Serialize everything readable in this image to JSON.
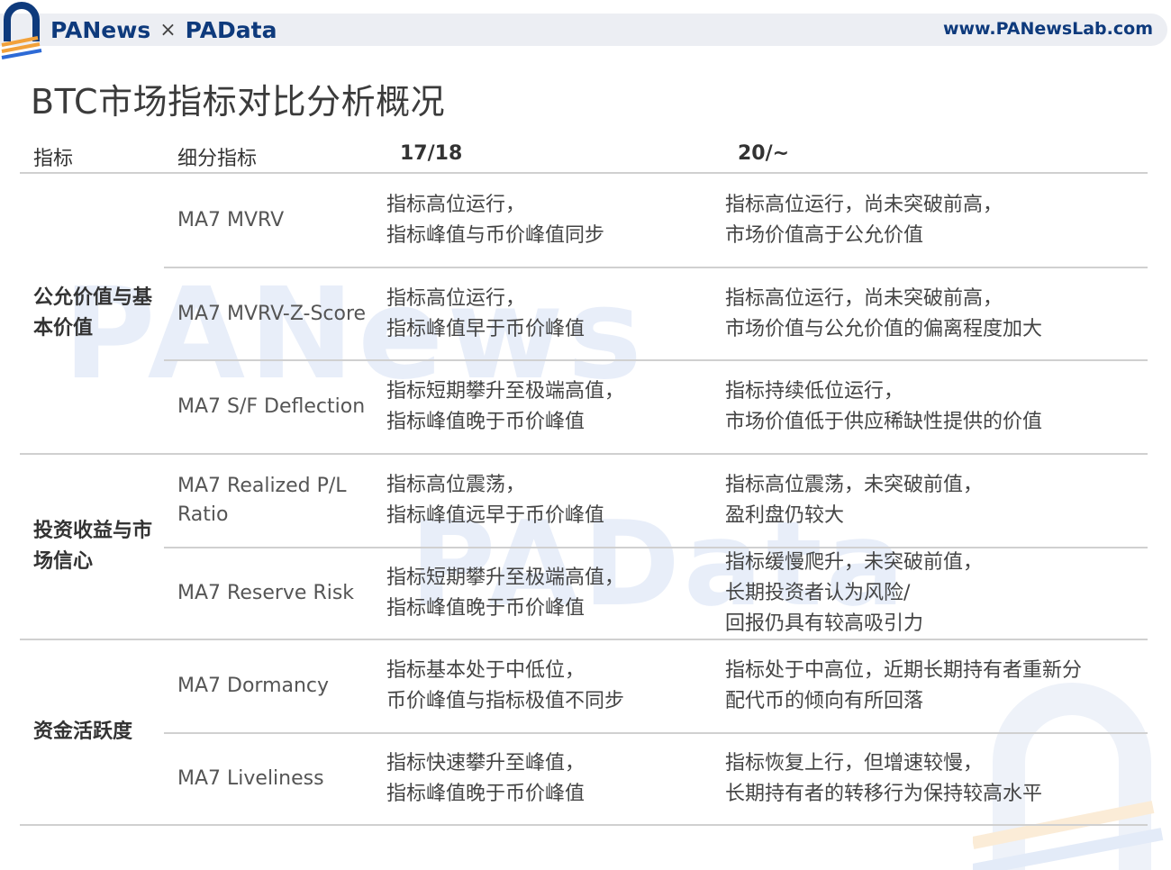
{
  "header": {
    "brand_left": "PANews",
    "brand_sep": "×",
    "brand_right": "PAData",
    "url": "www.PANewsLab.com",
    "accent_color": "#0e3a7c",
    "logo_icon": "panews-arch-logo"
  },
  "title": "BTC市场指标对比分析概况",
  "watermarks": [
    "PANews",
    "PAData"
  ],
  "table": {
    "headers": [
      "指标",
      "细分指标",
      "17/18",
      "20/~"
    ],
    "groups": [
      {
        "label": "公允价值与基本价值",
        "rows": [
          {
            "sub": "MA7 MVRV",
            "p1718": [
              "指标高位运行，",
              "指标峰值与币价峰值同步"
            ],
            "p20": [
              "指标高位运行，尚未突破前高，",
              "市场价值高于公允价值"
            ]
          },
          {
            "sub": "MA7 MVRV-Z-Score",
            "p1718": [
              "指标高位运行，",
              "指标峰值早于币价峰值"
            ],
            "p20": [
              "指标高位运行，尚未突破前高，",
              "市场价值与公允价值的偏离程度加大"
            ]
          },
          {
            "sub": "MA7 S/F Deflection",
            "p1718": [
              "指标短期攀升至极端高值，",
              "指标峰值晚于币价峰值"
            ],
            "p20": [
              "指标持续低位运行，",
              "市场价值低于供应稀缺性提供的价值"
            ]
          }
        ]
      },
      {
        "label": "投资收益与市场信心",
        "rows": [
          {
            "sub": "MA7 Realized P/L Ratio",
            "p1718": [
              "指标高位震荡，",
              "指标峰值远早于币价峰值"
            ],
            "p20": [
              "指标高位震荡，未突破前值，",
              "盈利盘仍较大"
            ]
          },
          {
            "sub": "MA7 Reserve Risk",
            "p1718": [
              "指标短期攀升至极端高值，",
              "指标峰值晚于币价峰值"
            ],
            "p20": [
              "指标缓慢爬升，未突破前值，",
              "长期投资者认为风险/",
              "回报仍具有较高吸引力"
            ]
          }
        ]
      },
      {
        "label": "资金活跃度",
        "rows": [
          {
            "sub": "MA7 Dormancy",
            "p1718": [
              "指标基本处于中低位，",
              "币价峰值与指标极值不同步"
            ],
            "p20": [
              "指标处于中高位，近期长期持有者重新分",
              "配代币的倾向有所回落"
            ]
          },
          {
            "sub": "MA7 Liveliness",
            "p1718": [
              "指标快速攀升至峰值，",
              "指标峰值晚于币价峰值"
            ],
            "p20": [
              "指标恢复上行，但增速较慢，",
              "长期持有者的转移行为保持较高水平"
            ]
          }
        ]
      }
    ]
  }
}
